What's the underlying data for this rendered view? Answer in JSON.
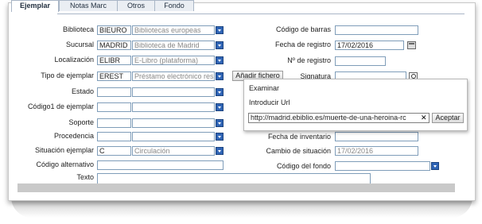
{
  "tabs": [
    {
      "label": "Ejemplar",
      "active": true
    },
    {
      "label": "Notas Marc",
      "active": false
    },
    {
      "label": "Otros",
      "active": false
    },
    {
      "label": "Fondo",
      "active": false
    }
  ],
  "left": {
    "biblioteca": {
      "label": "Biblioteca",
      "code": "BIEURO",
      "name": "Bibliotecas europeas"
    },
    "sucursal": {
      "label": "Sucursal",
      "code": "MADRID",
      "name": "Biblioteca de Madrid"
    },
    "localizacion": {
      "label": "Localización",
      "code": "ELIBR",
      "name": "E-Libro (plataforma)"
    },
    "tipo": {
      "label": "Tipo de ejemplar",
      "code": "EREST",
      "name": "Préstamo electrónico res"
    },
    "estado": {
      "label": "Estado",
      "code": "",
      "name": ""
    },
    "codigo1": {
      "label": "Código1 de ejemplar",
      "code": "",
      "name": ""
    },
    "soporte": {
      "label": "Soporte",
      "code": "",
      "name": ""
    },
    "procedencia": {
      "label": "Procedencia",
      "code": "",
      "name": ""
    },
    "situacion": {
      "label": "Situación ejemplar",
      "code": "C",
      "name": "Circulación"
    },
    "codigo_alt": {
      "label": "Código alternativo",
      "value": ""
    },
    "texto": {
      "label": "Texto",
      "value": ""
    }
  },
  "right": {
    "codigo_barras": {
      "label": "Código de barras",
      "value": ""
    },
    "fecha_registro": {
      "label": "Fecha de registro",
      "value": "17/02/2016"
    },
    "num_registro": {
      "label": "Nº de registro",
      "value": ""
    },
    "signatura": {
      "label": "Signatura",
      "value": ""
    },
    "fecha_inventario": {
      "label": "Fecha de inventario",
      "value": ""
    },
    "cambio_situacion": {
      "label": "Cambio de situación",
      "value": "17/02/2016"
    },
    "codigo_fondo": {
      "label": "Código del fondo",
      "value": ""
    }
  },
  "anadir_button": "Añadir fichero",
  "popup": {
    "examinar": "Examinar",
    "introducir_url": "Introducir Url",
    "url_value": "http://madrid.ebiblio.es/muerte-de-una-heroina-rc",
    "clear_glyph": "✕",
    "accept_label": "Aceptar"
  },
  "icons": {
    "dropdown": "chevron-down-icon",
    "calendar": "calendar-icon",
    "search": "search-icon"
  },
  "colors": {
    "dropdown": "#2f64b5",
    "border": "#7f9db9",
    "tab_bg": "#eaeef3"
  }
}
